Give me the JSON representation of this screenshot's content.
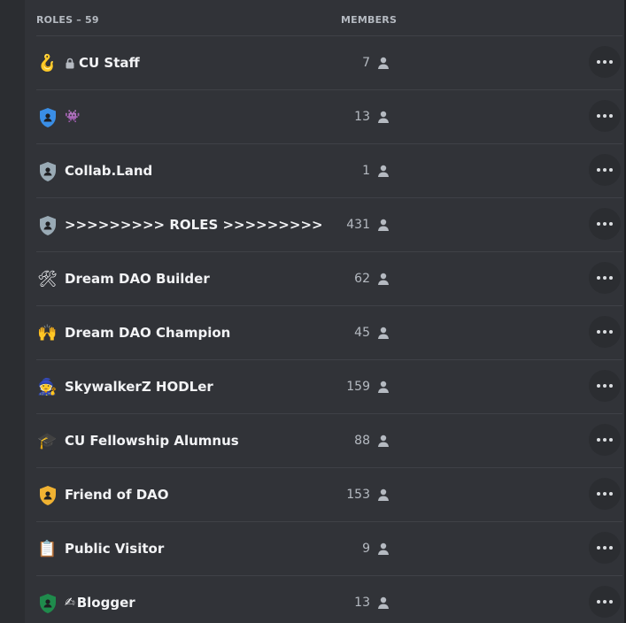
{
  "header": {
    "roles_label": "ROLES – 59",
    "members_label": "MEMBERS"
  },
  "colors": {
    "background": "#313338",
    "divider": "#3f4147",
    "muted": "#b5bac1",
    "text": "#f2f3f5"
  },
  "roles": [
    {
      "name": "CU Staff",
      "count": "7",
      "icon": "hook-emoji-icon",
      "icon_glyph": "🪝",
      "locked": true
    },
    {
      "name": "",
      "count": "13",
      "icon": "shield-icon",
      "icon_color": "#3a8ee6",
      "extra_emoji": "👾"
    },
    {
      "name": "Collab.Land",
      "count": "1",
      "icon": "shield-icon",
      "icon_color": "#99aab5"
    },
    {
      "name": ">>>>>>>>> ROLES >>>>>>>>>",
      "count": "431",
      "icon": "shield-icon",
      "icon_color": "#99aab5"
    },
    {
      "name": "Dream DAO Builder",
      "count": "62",
      "icon": "hammer-wrench-icon",
      "icon_glyph": "🛠"
    },
    {
      "name": "Dream DAO Champion",
      "count": "45",
      "icon": "raising-hands-icon",
      "icon_glyph": "🙌"
    },
    {
      "name": "SkywalkerZ HODLer",
      "count": "159",
      "icon": "mage-icon",
      "icon_glyph": "🧙"
    },
    {
      "name": "CU Fellowship Alumnus",
      "count": "88",
      "icon": "graduation-cap-icon",
      "icon_glyph": "🎓"
    },
    {
      "name": "Friend of DAO",
      "count": "153",
      "icon": "shield-icon",
      "icon_color": "#f0b232"
    },
    {
      "name": "Public Visitor",
      "count": "9",
      "icon": "clipboard-icon",
      "icon_glyph": "📋"
    },
    {
      "name": "Blogger",
      "count": "13",
      "icon": "shield-icon",
      "icon_color": "#1f8b4c",
      "extra_emoji": "✍"
    }
  ]
}
